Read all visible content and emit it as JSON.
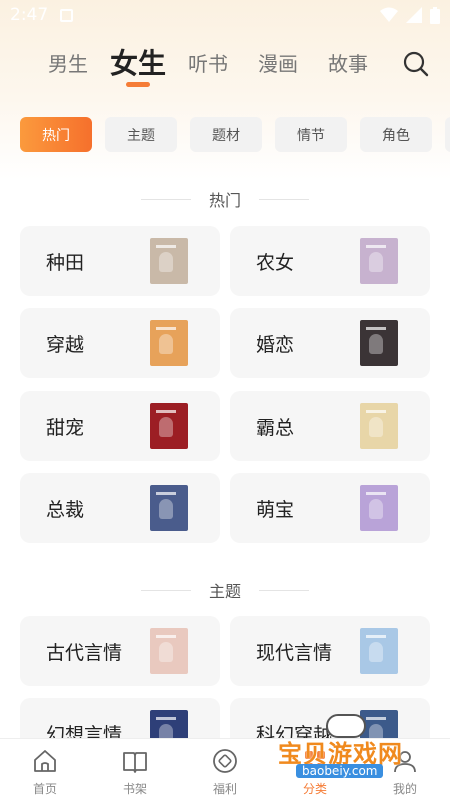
{
  "status_bar": {
    "time": "2:47"
  },
  "top_tabs": [
    {
      "label": "男生",
      "active": false
    },
    {
      "label": "女生",
      "active": true
    },
    {
      "label": "听书",
      "active": false
    },
    {
      "label": "漫画",
      "active": false
    },
    {
      "label": "故事",
      "active": false
    }
  ],
  "filter_chips": [
    {
      "label": "热门",
      "active": true
    },
    {
      "label": "主题",
      "active": false
    },
    {
      "label": "题材",
      "active": false
    },
    {
      "label": "情节",
      "active": false
    },
    {
      "label": "角色",
      "active": false
    }
  ],
  "sections": [
    {
      "title": "热门",
      "items": [
        {
          "label": "种田",
          "cover_color": "#c9b9a8"
        },
        {
          "label": "农女",
          "cover_color": "#c7b2cf"
        },
        {
          "label": "穿越",
          "cover_color": "#e7a25a"
        },
        {
          "label": "婚恋",
          "cover_color": "#3b3436"
        },
        {
          "label": "甜宠",
          "cover_color": "#9c1e24"
        },
        {
          "label": "霸总",
          "cover_color": "#e8d6a8"
        },
        {
          "label": "总裁",
          "cover_color": "#4a5c8c"
        },
        {
          "label": "萌宝",
          "cover_color": "#b9a3d8"
        }
      ]
    },
    {
      "title": "主题",
      "items": [
        {
          "label": "古代言情",
          "cover_color": "#e9c9bf"
        },
        {
          "label": "现代言情",
          "cover_color": "#a9c8e6"
        },
        {
          "label": "幻想言情",
          "cover_color": "#2e3f78"
        },
        {
          "label": "科幻穿越",
          "cover_color": "#3c5a8a"
        }
      ]
    }
  ],
  "bottom_nav": [
    {
      "label": "首页",
      "icon": "home-icon",
      "active": false
    },
    {
      "label": "书架",
      "icon": "bookshelf-icon",
      "active": false
    },
    {
      "label": "福利",
      "icon": "welfare-icon",
      "active": false
    },
    {
      "label": "分类",
      "icon": "category-icon",
      "active": true
    },
    {
      "label": "我的",
      "icon": "profile-icon",
      "active": false
    }
  ],
  "watermark": {
    "text": "宝贝游戏网",
    "url": "baobeiy.com"
  },
  "colors": {
    "accent": "#f57c36",
    "chip_gradient_start": "#fb9a3d",
    "card_bg": "#f6f6f6"
  }
}
